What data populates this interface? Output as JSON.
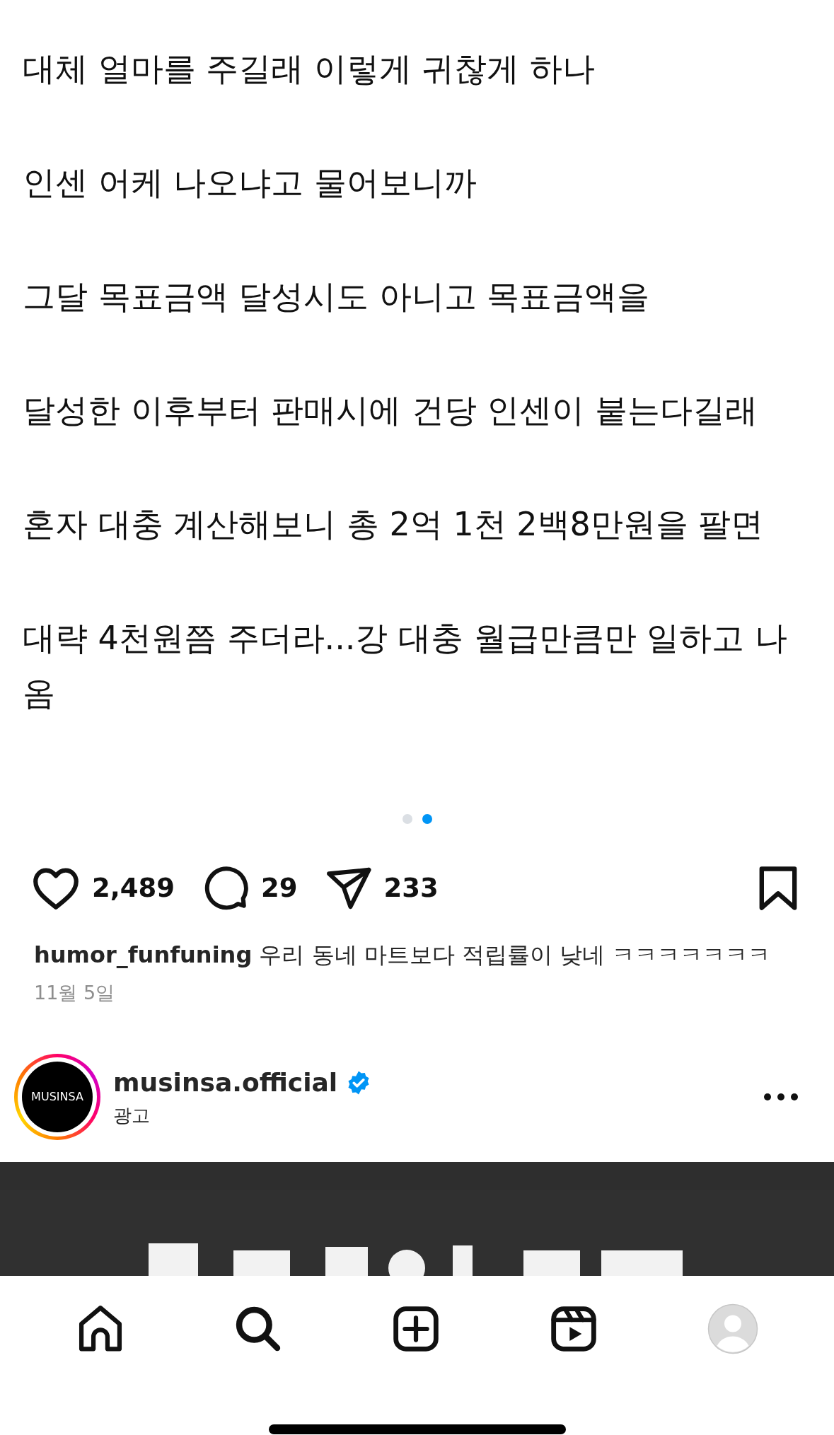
{
  "post": {
    "body_lines": [
      "대체 얼마를 주길래 이렇게 귀찮게 하나",
      "인센 어케 나오냐고 물어보니까",
      "그달 목표금액 달성시도 아니고 목표금액을",
      "달성한 이후부터 판매시에 건당 인센이 붙는다길래",
      "혼자 대충 계산해보니 총 2억 1천 2백8만원을 팔면",
      "대략 4천원쯤 주더라...강 대충 월급만큼만 일하고 나옴"
    ],
    "carousel": [
      {
        "selected": false
      },
      {
        "selected": true
      }
    ],
    "actions": [
      {
        "kind": "like",
        "count": "2,489"
      },
      {
        "kind": "comment",
        "count": "29"
      },
      {
        "kind": "share",
        "count": "233"
      }
    ],
    "caption": {
      "username": "humor_funfuning",
      "text": "우리 동네 마트보다 적립률이 낮네 ㅋㅋㅋㅋㅋㅋㅋ"
    },
    "date": "11월 5일"
  },
  "ad": {
    "avatar_label": "MUSINSA",
    "username": "musinsa.official",
    "verified": true,
    "label": "광고"
  },
  "nav": [
    {
      "kind": "home"
    },
    {
      "kind": "search"
    },
    {
      "kind": "create"
    },
    {
      "kind": "reels"
    },
    {
      "kind": "profile"
    }
  ]
}
